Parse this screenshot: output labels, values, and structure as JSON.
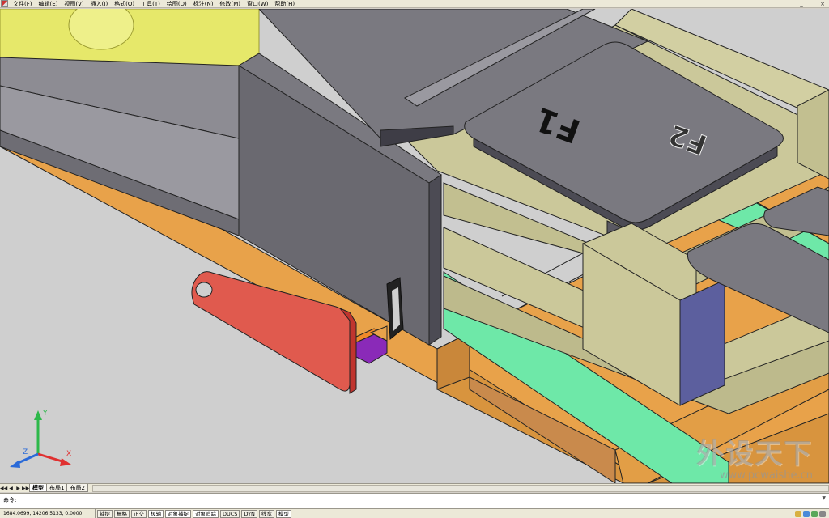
{
  "menu": {
    "items": [
      "文件(F)",
      "编辑(E)",
      "视图(V)",
      "插入(I)",
      "格式(O)",
      "工具(T)",
      "绘图(D)",
      "标注(N)",
      "修改(M)",
      "窗口(W)",
      "帮助(H)"
    ],
    "window_controls": [
      "_",
      "□",
      "×"
    ]
  },
  "viewport": {
    "key_caps": {
      "primary": "F1",
      "secondary": "F2"
    },
    "ucs_axes": {
      "x": "X",
      "y": "Y",
      "z": "Z"
    },
    "watermark": {
      "title": "外设天下",
      "url": "www.pcwaishe.cn"
    }
  },
  "tabs": {
    "nav": [
      "◀◀",
      "◀",
      "▶",
      "▶▶"
    ],
    "items": [
      "模型",
      "布局1",
      "布局2"
    ],
    "active": 0
  },
  "command": {
    "prompt": "命令:",
    "scroll_arrow": "▼"
  },
  "status": {
    "coords": "1684.0699, 14206.5133, 0.0000",
    "toggles": [
      "捕捉",
      "栅格",
      "正交",
      "极轴",
      "对象捕捉",
      "对象追踪",
      "DUCS",
      "DYN",
      "线宽",
      "模型"
    ],
    "toggle_on": [
      false,
      false,
      false,
      true,
      true,
      true,
      false,
      false,
      false,
      true
    ]
  },
  "colors": {
    "yellow_body": "#e6e86a",
    "gray_plate": "#7a7980",
    "dark_side": "#4c4b54",
    "stem_beige": "#cbc89a",
    "cyan_strip": "#6ee8a8",
    "orange_base": "#e8a24a",
    "red_lever": "#e05a4e",
    "purple_pin": "#8a2ab8",
    "viewport_bg": "#cfcfcf"
  }
}
